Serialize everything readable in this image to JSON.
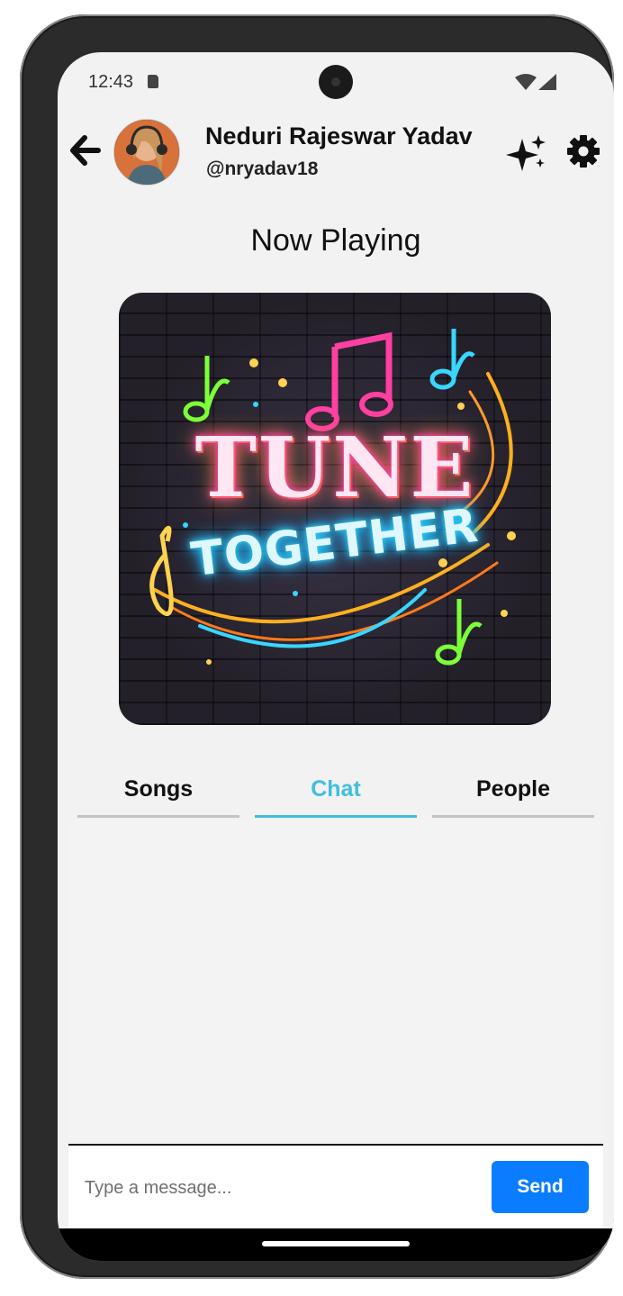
{
  "status_bar": {
    "time": "12:43",
    "icons": [
      "sd-card-icon",
      "wifi-icon",
      "cell-signal-icon"
    ]
  },
  "header": {
    "back_icon": "arrow-left-icon",
    "user_name": "Neduri Rajeswar Yadav",
    "user_handle": "@nryadav18",
    "sparkle_icon": "sparkles-icon",
    "settings_icon": "gear-icon"
  },
  "now_playing": {
    "title": "Now Playing",
    "album_art": {
      "line1": "TUNE",
      "line2": "TOGETHER"
    }
  },
  "tabs": [
    {
      "label": "Songs",
      "active": false
    },
    {
      "label": "Chat",
      "active": true
    },
    {
      "label": "People",
      "active": false
    }
  ],
  "composer": {
    "placeholder": "Type a message...",
    "value": "",
    "send_label": "Send"
  },
  "colors": {
    "accent": "#3fbfdd",
    "send_button": "#0a7cff",
    "background": "#f2f2f2"
  }
}
